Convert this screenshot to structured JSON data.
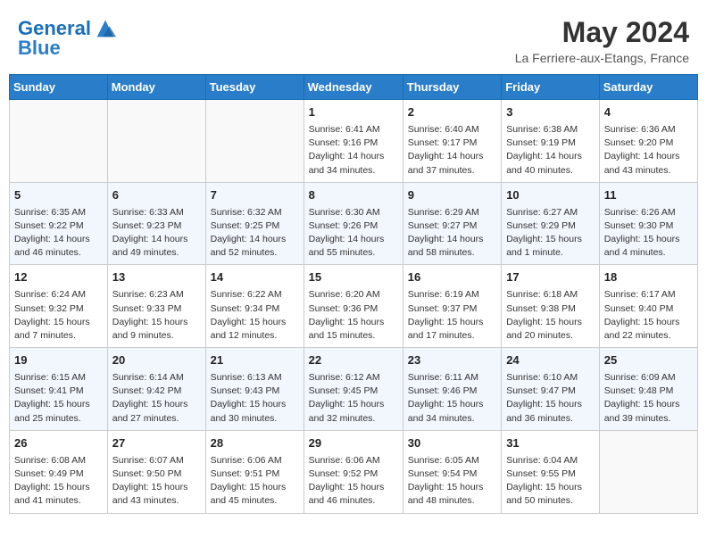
{
  "header": {
    "logo_line1": "General",
    "logo_line2": "Blue",
    "month": "May 2024",
    "location": "La Ferriere-aux-Etangs, France"
  },
  "days_of_week": [
    "Sunday",
    "Monday",
    "Tuesday",
    "Wednesday",
    "Thursday",
    "Friday",
    "Saturday"
  ],
  "weeks": [
    [
      {
        "day": "",
        "content": ""
      },
      {
        "day": "",
        "content": ""
      },
      {
        "day": "",
        "content": ""
      },
      {
        "day": "1",
        "content": "Sunrise: 6:41 AM\nSunset: 9:16 PM\nDaylight: 14 hours and 34 minutes."
      },
      {
        "day": "2",
        "content": "Sunrise: 6:40 AM\nSunset: 9:17 PM\nDaylight: 14 hours and 37 minutes."
      },
      {
        "day": "3",
        "content": "Sunrise: 6:38 AM\nSunset: 9:19 PM\nDaylight: 14 hours and 40 minutes."
      },
      {
        "day": "4",
        "content": "Sunrise: 6:36 AM\nSunset: 9:20 PM\nDaylight: 14 hours and 43 minutes."
      }
    ],
    [
      {
        "day": "5",
        "content": "Sunrise: 6:35 AM\nSunset: 9:22 PM\nDaylight: 14 hours and 46 minutes."
      },
      {
        "day": "6",
        "content": "Sunrise: 6:33 AM\nSunset: 9:23 PM\nDaylight: 14 hours and 49 minutes."
      },
      {
        "day": "7",
        "content": "Sunrise: 6:32 AM\nSunset: 9:25 PM\nDaylight: 14 hours and 52 minutes."
      },
      {
        "day": "8",
        "content": "Sunrise: 6:30 AM\nSunset: 9:26 PM\nDaylight: 14 hours and 55 minutes."
      },
      {
        "day": "9",
        "content": "Sunrise: 6:29 AM\nSunset: 9:27 PM\nDaylight: 14 hours and 58 minutes."
      },
      {
        "day": "10",
        "content": "Sunrise: 6:27 AM\nSunset: 9:29 PM\nDaylight: 15 hours and 1 minute."
      },
      {
        "day": "11",
        "content": "Sunrise: 6:26 AM\nSunset: 9:30 PM\nDaylight: 15 hours and 4 minutes."
      }
    ],
    [
      {
        "day": "12",
        "content": "Sunrise: 6:24 AM\nSunset: 9:32 PM\nDaylight: 15 hours and 7 minutes."
      },
      {
        "day": "13",
        "content": "Sunrise: 6:23 AM\nSunset: 9:33 PM\nDaylight: 15 hours and 9 minutes."
      },
      {
        "day": "14",
        "content": "Sunrise: 6:22 AM\nSunset: 9:34 PM\nDaylight: 15 hours and 12 minutes."
      },
      {
        "day": "15",
        "content": "Sunrise: 6:20 AM\nSunset: 9:36 PM\nDaylight: 15 hours and 15 minutes."
      },
      {
        "day": "16",
        "content": "Sunrise: 6:19 AM\nSunset: 9:37 PM\nDaylight: 15 hours and 17 minutes."
      },
      {
        "day": "17",
        "content": "Sunrise: 6:18 AM\nSunset: 9:38 PM\nDaylight: 15 hours and 20 minutes."
      },
      {
        "day": "18",
        "content": "Sunrise: 6:17 AM\nSunset: 9:40 PM\nDaylight: 15 hours and 22 minutes."
      }
    ],
    [
      {
        "day": "19",
        "content": "Sunrise: 6:15 AM\nSunset: 9:41 PM\nDaylight: 15 hours and 25 minutes."
      },
      {
        "day": "20",
        "content": "Sunrise: 6:14 AM\nSunset: 9:42 PM\nDaylight: 15 hours and 27 minutes."
      },
      {
        "day": "21",
        "content": "Sunrise: 6:13 AM\nSunset: 9:43 PM\nDaylight: 15 hours and 30 minutes."
      },
      {
        "day": "22",
        "content": "Sunrise: 6:12 AM\nSunset: 9:45 PM\nDaylight: 15 hours and 32 minutes."
      },
      {
        "day": "23",
        "content": "Sunrise: 6:11 AM\nSunset: 9:46 PM\nDaylight: 15 hours and 34 minutes."
      },
      {
        "day": "24",
        "content": "Sunrise: 6:10 AM\nSunset: 9:47 PM\nDaylight: 15 hours and 36 minutes."
      },
      {
        "day": "25",
        "content": "Sunrise: 6:09 AM\nSunset: 9:48 PM\nDaylight: 15 hours and 39 minutes."
      }
    ],
    [
      {
        "day": "26",
        "content": "Sunrise: 6:08 AM\nSunset: 9:49 PM\nDaylight: 15 hours and 41 minutes."
      },
      {
        "day": "27",
        "content": "Sunrise: 6:07 AM\nSunset: 9:50 PM\nDaylight: 15 hours and 43 minutes."
      },
      {
        "day": "28",
        "content": "Sunrise: 6:06 AM\nSunset: 9:51 PM\nDaylight: 15 hours and 45 minutes."
      },
      {
        "day": "29",
        "content": "Sunrise: 6:06 AM\nSunset: 9:52 PM\nDaylight: 15 hours and 46 minutes."
      },
      {
        "day": "30",
        "content": "Sunrise: 6:05 AM\nSunset: 9:54 PM\nDaylight: 15 hours and 48 minutes."
      },
      {
        "day": "31",
        "content": "Sunrise: 6:04 AM\nSunset: 9:55 PM\nDaylight: 15 hours and 50 minutes."
      },
      {
        "day": "",
        "content": ""
      }
    ]
  ]
}
